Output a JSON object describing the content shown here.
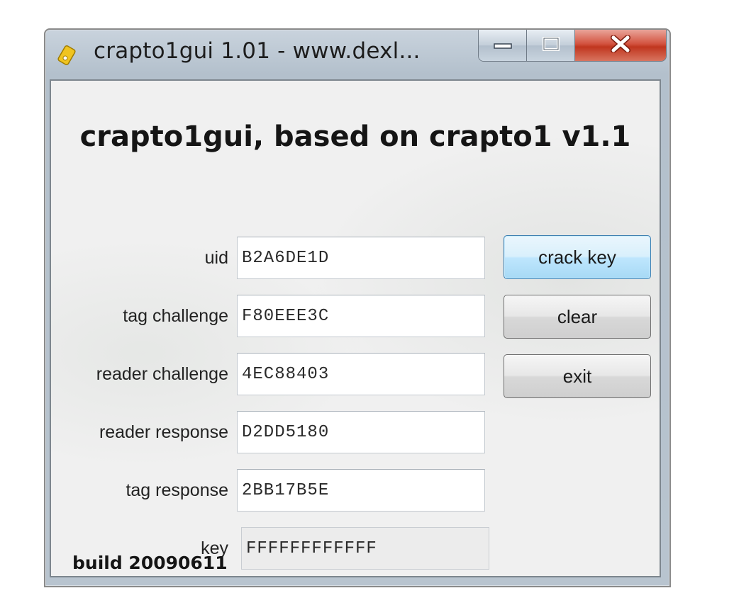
{
  "window": {
    "title": "crapto1gui 1.01 - www.dexl...",
    "controls": {
      "minimize": "minimize-icon",
      "maximize": "maximize-icon",
      "close": "close-icon"
    }
  },
  "heading": "crapto1gui, based on crapto1 v1.1",
  "fields": [
    {
      "label": "uid",
      "value": "B2A6DE1D"
    },
    {
      "label": "tag challenge",
      "value": "F80EEE3C"
    },
    {
      "label": "reader challenge",
      "value": "4EC88403"
    },
    {
      "label": "reader response",
      "value": "D2DD5180"
    },
    {
      "label": "tag response",
      "value": "2BB17B5E"
    },
    {
      "label": "key",
      "value": "FFFFFFFFFFFF"
    }
  ],
  "buttons": {
    "crack_key": "crack key",
    "clear": "clear",
    "exit": "exit"
  },
  "build": "build 20090611",
  "colors": {
    "default_button": "#bee6fd",
    "close_button": "#c0361f"
  }
}
